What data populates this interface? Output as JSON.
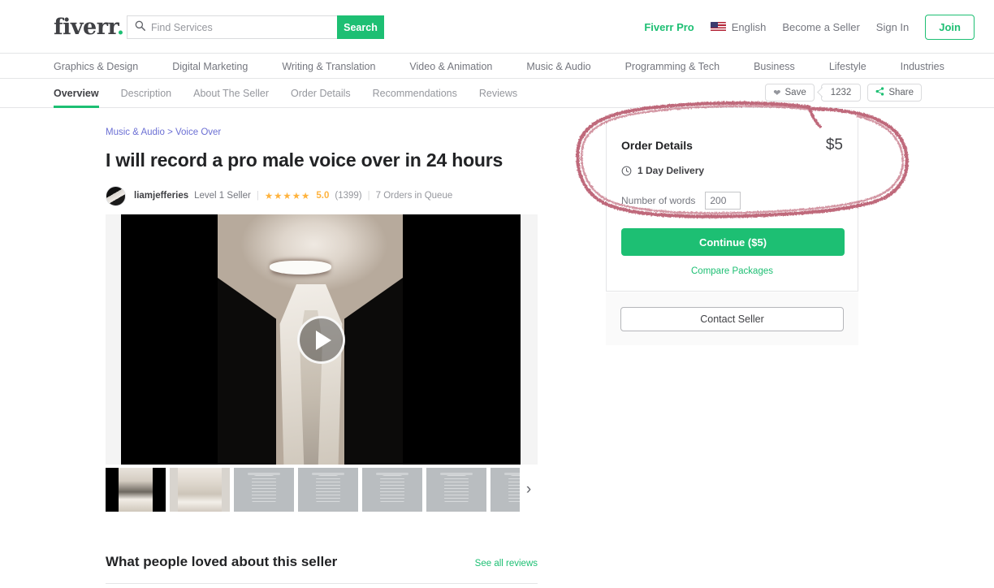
{
  "header": {
    "logo": "fiverr",
    "logo_dot": ".",
    "search": {
      "placeholder": "Find Services",
      "value": "",
      "button": "Search",
      "icon": "search-icon"
    },
    "pro_link": "Fiverr Pro",
    "language": "English",
    "flag_icon": "us-flag-icon",
    "become_seller": "Become a Seller",
    "sign_in": "Sign In",
    "join": "Join"
  },
  "categories": [
    "Graphics & Design",
    "Digital Marketing",
    "Writing & Translation",
    "Video & Animation",
    "Music & Audio",
    "Programming & Tech",
    "Business",
    "Lifestyle",
    "Industries"
  ],
  "tabs": [
    {
      "label": "Overview",
      "active": true
    },
    {
      "label": "Description",
      "active": false
    },
    {
      "label": "About The Seller",
      "active": false
    },
    {
      "label": "Order Details",
      "active": false
    },
    {
      "label": "Recommendations",
      "active": false
    },
    {
      "label": "Reviews",
      "active": false
    }
  ],
  "actions": {
    "save_label": "Save",
    "save_icon": "heart-icon",
    "save_count": "1232",
    "share_label": "Share",
    "share_icon": "share-icon"
  },
  "gig": {
    "breadcrumb": {
      "parent": "Music & Audio",
      "separator": ">",
      "child": "Voice Over"
    },
    "title": "I will record a pro male voice over in 24 hours",
    "seller": {
      "avatar_icon": "seller-avatar",
      "name": "liamjefferies",
      "level": "Level 1 Seller",
      "separator": "|",
      "stars": "★★★★★",
      "rating": "5.0",
      "reviews": "(1399)",
      "queue": "7 Orders in Queue"
    },
    "video": {
      "play_icon": "play-icon"
    },
    "thumbnails": [
      {
        "kind": "dark",
        "name": "thumbnail-1"
      },
      {
        "kind": "light",
        "name": "thumbnail-2"
      },
      {
        "kind": "mic",
        "name": "thumbnail-3"
      },
      {
        "kind": "mic",
        "name": "thumbnail-4"
      },
      {
        "kind": "mic",
        "name": "thumbnail-5"
      },
      {
        "kind": "mic",
        "name": "thumbnail-6"
      },
      {
        "kind": "mic",
        "name": "thumbnail-7"
      }
    ],
    "thumbnail_next_icon": "›"
  },
  "order": {
    "title": "Order Details",
    "price": "$5",
    "delivery": "1 Day Delivery",
    "delivery_icon": "clock-icon",
    "words_label": "Number of words",
    "words_value": "200",
    "continue_label": "Continue ($5)",
    "compare_label": "Compare Packages",
    "contact_label": "Contact Seller"
  },
  "reviews": {
    "heading": "What people loved about this seller",
    "see_all": "See all reviews"
  },
  "annotation": {
    "shape": "hand-drawn-ellipse",
    "color": "#b24a5f",
    "target": "order-details-panel"
  },
  "colors": {
    "brand_green": "#1dbf73",
    "text_dark": "#404145",
    "text_muted": "#95979d",
    "link_purple": "#6c70d4",
    "star_gold": "#ffb33e",
    "annotation_red": "#b24a5f"
  }
}
